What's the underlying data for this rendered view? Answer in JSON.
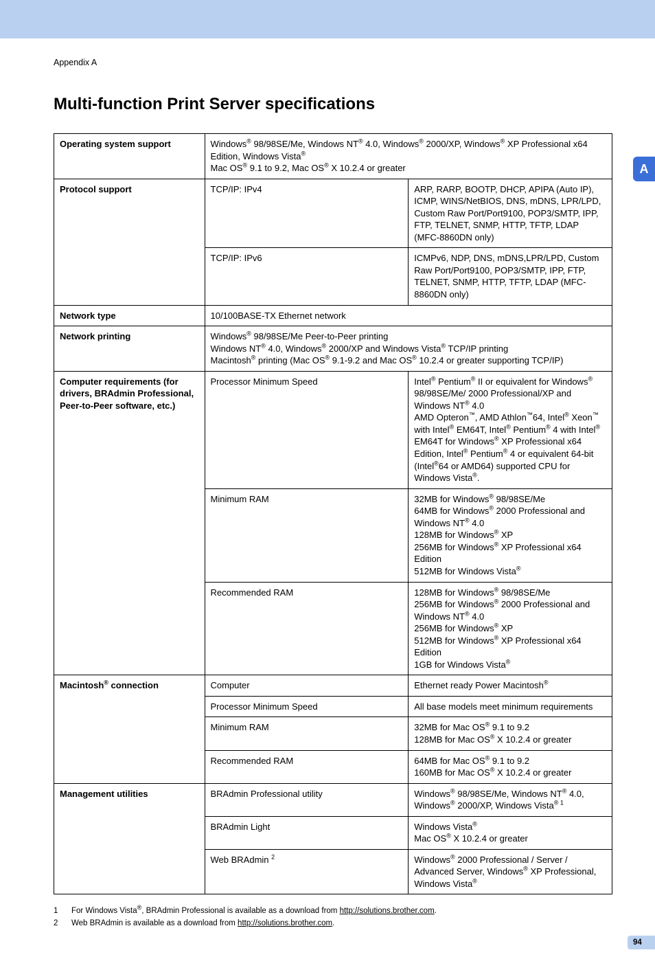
{
  "breadcrumb": "Appendix A",
  "title": "Multi-function Print Server specifications",
  "side_tab": "A",
  "page_number": "94",
  "rows": {
    "os_support": {
      "label": "Operating system support",
      "value_html": "Windows<sup>®</sup> 98/98SE/Me, Windows NT<sup>®</sup> 4.0, Windows<sup>®</sup> 2000/XP, Windows<sup>®</sup> XP Professional x64 Edition, Windows Vista<sup>®</sup><br>Mac OS<sup>®</sup> 9.1 to 9.2, Mac OS<sup>®</sup> X 10.2.4 or greater"
    },
    "protocol": {
      "label": "Protocol support",
      "ipv4_label": "TCP/IP: IPv4",
      "ipv4_value": "ARP, RARP, BOOTP, DHCP, APIPA (Auto IP), ICMP, WINS/NetBIOS, DNS, mDNS, LPR/LPD, Custom Raw Port/Port9100, POP3/SMTP, IPP, FTP, TELNET, SNMP, HTTP, TFTP, LDAP (MFC-8860DN only)",
      "ipv6_label": "TCP/IP: IPv6",
      "ipv6_value": "ICMPv6, NDP, DNS, mDNS,LPR/LPD, Custom Raw Port/Port9100, POP3/SMTP, IPP, FTP, TELNET, SNMP, HTTP, TFTP, LDAP (MFC-8860DN only)"
    },
    "network_type": {
      "label": "Network type",
      "value": "10/100BASE-TX Ethernet network"
    },
    "network_printing": {
      "label": "Network printing",
      "value_html": "Windows<sup>®</sup> 98/98SE/Me Peer-to-Peer printing<br>Windows NT<sup>®</sup> 4.0, Windows<sup>®</sup> 2000/XP and Windows Vista<sup>®</sup> TCP/IP printing<br>Macintosh<sup>®</sup> printing (Mac OS<sup>®</sup> 9.1-9.2 and Mac OS<sup>®</sup> 10.2.4 or greater supporting TCP/IP)"
    },
    "computer_req": {
      "label": "Computer requirements (for drivers, BRAdmin Professional, Peer-to-Peer software, etc.)",
      "proc_label": "Processor Minimum Speed",
      "proc_value_html": "Intel<sup>®</sup> Pentium<sup>®</sup> II or equivalent for Windows<sup>®</sup> 98/98SE/Me/ 2000 Professional/XP and Windows NT<sup>®</sup> 4.0<br>AMD Opteron<sup>™</sup>, AMD Athlon<sup>™</sup>64, Intel<sup>®</sup> Xeon<sup>™</sup> with Intel<sup>®</sup> EM64T, Intel<sup>®</sup> Pentium<sup>®</sup> 4 with Intel<sup>®</sup> EM64T for Windows<sup>®</sup> XP Professional x64 Edition, Intel<sup>®</sup> Pentium<sup>®</sup> 4 or equivalent 64-bit (Intel<sup>®</sup>64 or AMD64) supported CPU for Windows Vista<sup>®</sup>.",
      "minram_label": "Minimum RAM",
      "minram_value_html": "32MB for Windows<sup>®</sup> 98/98SE/Me<br>64MB for Windows<sup>®</sup> 2000 Professional and Windows NT<sup>®</sup> 4.0<br>128MB for Windows<sup>®</sup> XP<br>256MB for Windows<sup>®</sup> XP Professional x64 Edition<br>512MB for Windows Vista<sup>®</sup>",
      "recram_label": "Recommended RAM",
      "recram_value_html": "128MB for Windows<sup>®</sup> 98/98SE/Me<br>256MB for Windows<sup>®</sup> 2000 Professional and Windows NT<sup>®</sup> 4.0<br>256MB for Windows<sup>®</sup> XP<br>512MB for Windows<sup>®</sup> XP Professional x64 Edition<br>1GB for Windows Vista<sup>®</sup>"
    },
    "mac_conn": {
      "label_html": "Macintosh<sup>®</sup> connection",
      "computer_label": "Computer",
      "computer_value_html": "Ethernet ready Power Macintosh<sup>®</sup>",
      "proc_label": "Processor Minimum Speed",
      "proc_value": "All base models meet minimum requirements",
      "minram_label": "Minimum RAM",
      "minram_value_html": "32MB for Mac OS<sup>®</sup> 9.1 to 9.2<br>128MB for Mac OS<sup>®</sup> X 10.2.4 or greater",
      "recram_label": "Recommended RAM",
      "recram_value_html": "64MB for Mac OS<sup>®</sup> 9.1 to 9.2<br>160MB for Mac OS<sup>®</sup> X 10.2.4 or greater"
    },
    "mgmt": {
      "label": "Management utilities",
      "bradmin_pro_label": "BRAdmin Professional utility",
      "bradmin_pro_value_html": "Windows<sup>®</sup> 98/98SE/Me, Windows NT<sup>®</sup> 4.0, Windows<sup>®</sup> 2000/XP, Windows Vista<sup>® 1</sup>",
      "bradmin_light_label": "BRAdmin Light",
      "bradmin_light_value_html": "Windows Vista<sup>®</sup><br>Mac OS<sup>®</sup> X 10.2.4 or greater",
      "web_bradmin_label_html": "Web BRAdmin <sup>2</sup>",
      "web_bradmin_value_html": "Windows<sup>®</sup> 2000 Professional / Server / Advanced Server, Windows<sup>®</sup> XP Professional, Windows Vista<sup>®</sup>"
    }
  },
  "footnotes": [
    {
      "num": "1",
      "html": "For Windows Vista<sup>®</sup>, BRAdmin Professional is available as a download from <span class=\"lnk\">http://solutions.brother.com</span>."
    },
    {
      "num": "2",
      "html": "Web BRAdmin is available as a download from <span class=\"lnk\">http://solutions.brother.com</span>."
    }
  ]
}
